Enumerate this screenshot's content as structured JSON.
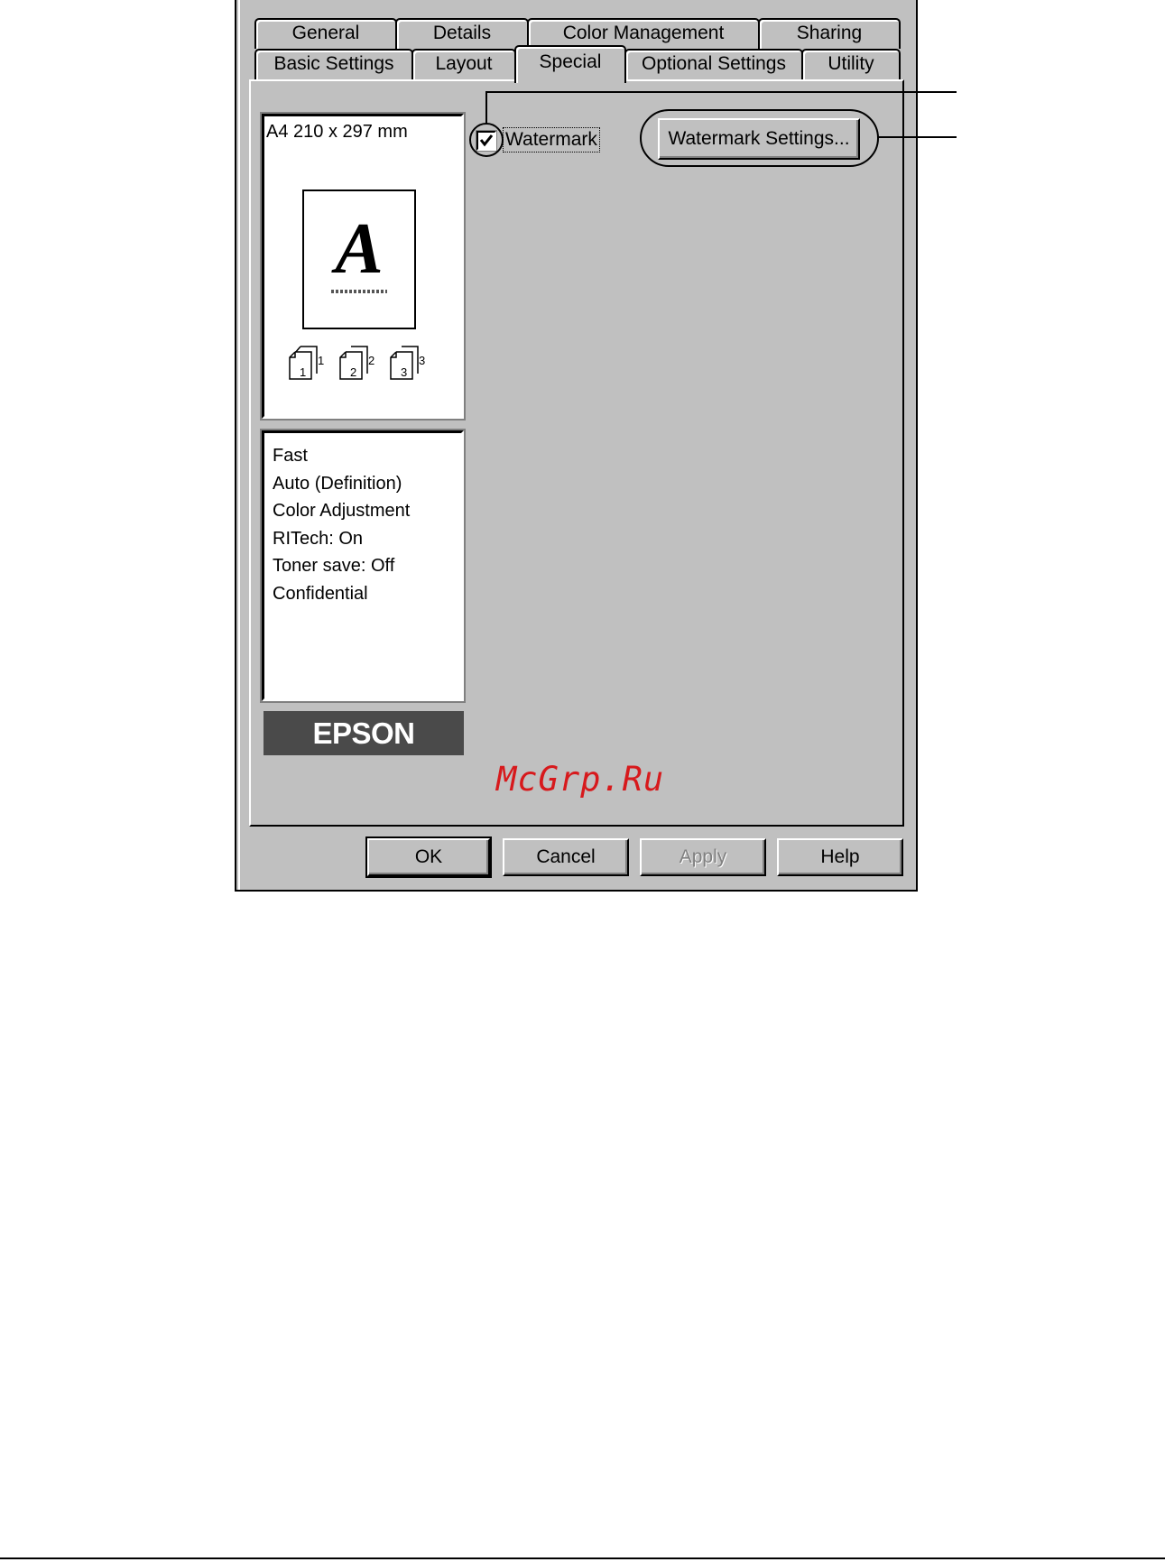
{
  "tabs_row1": [
    {
      "label": "General"
    },
    {
      "label": "Details"
    },
    {
      "label": "Color Management"
    },
    {
      "label": "Sharing"
    }
  ],
  "tabs_row2": [
    {
      "label": "Basic Settings"
    },
    {
      "label": "Layout"
    },
    {
      "label": "Special",
      "active": true
    },
    {
      "label": "Optional Settings"
    },
    {
      "label": "Utility"
    }
  ],
  "preview": {
    "paper_size": "A4 210 x 297 mm",
    "page_letter": "A",
    "copies": [
      "1",
      "2",
      "3"
    ]
  },
  "summary_lines": [
    "Fast",
    "Auto (Definition)",
    "Color Adjustment",
    "RITech: On",
    "Toner save: Off",
    "Confidential"
  ],
  "logo": "EPSON",
  "watermark": {
    "checkbox_label": "Watermark",
    "checked": true,
    "settings_button": "Watermark Settings..."
  },
  "buttons": {
    "ok": "OK",
    "cancel": "Cancel",
    "apply": "Apply",
    "help": "Help"
  },
  "site_watermark": "McGrp.Ru"
}
